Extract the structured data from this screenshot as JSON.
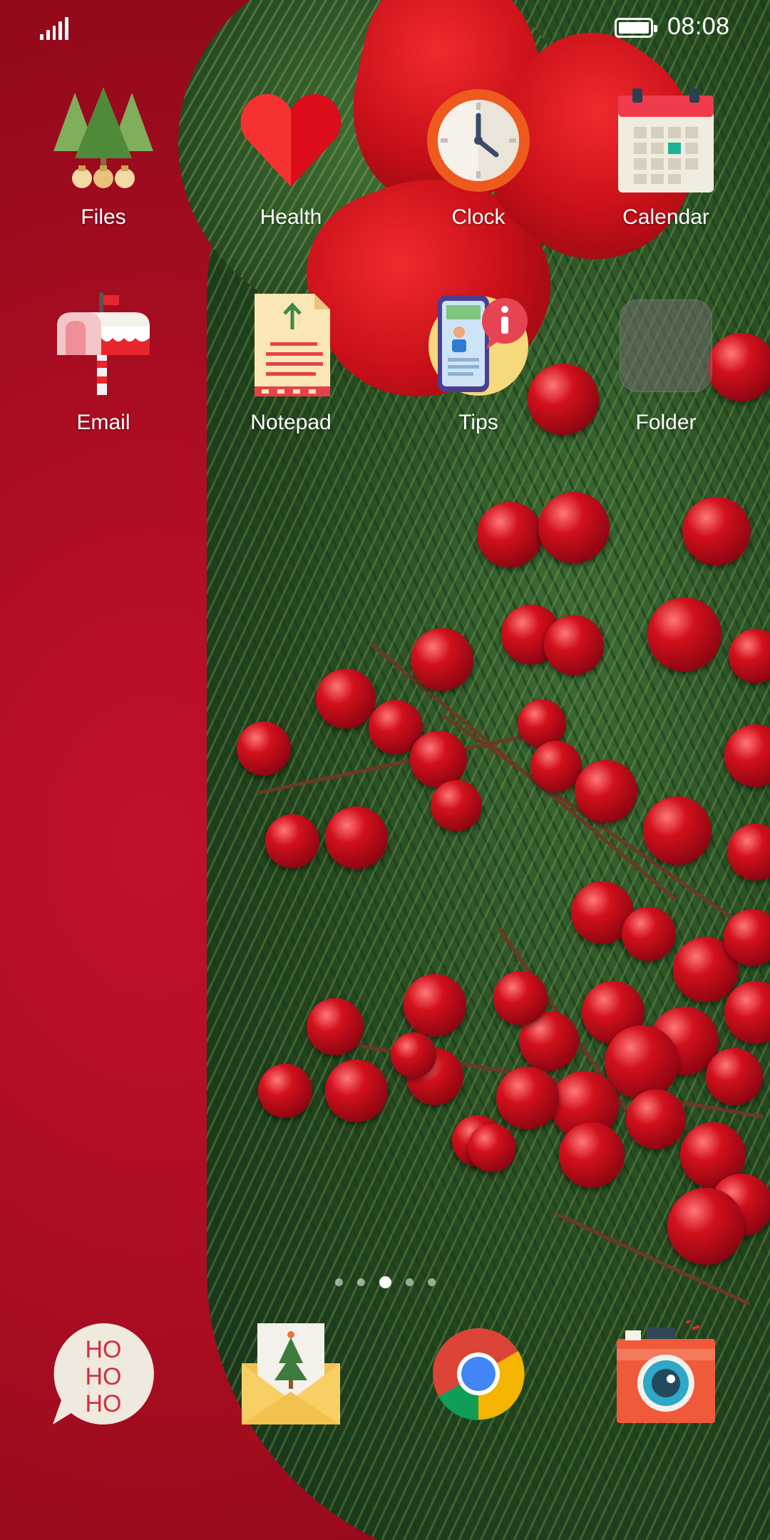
{
  "status_bar": {
    "time": "08:08",
    "signal_icon": "signal-icon",
    "battery_icon": "battery-icon"
  },
  "home_apps": [
    {
      "label": "Files",
      "icon": "pine-trees-icon"
    },
    {
      "label": "Health",
      "icon": "heart-icon"
    },
    {
      "label": "Clock",
      "icon": "clock-icon"
    },
    {
      "label": "Calendar",
      "icon": "calendar-icon"
    },
    {
      "label": "Email",
      "icon": "mailbox-icon"
    },
    {
      "label": "Notepad",
      "icon": "notepad-icon"
    },
    {
      "label": "Tips",
      "icon": "tips-icon"
    },
    {
      "label": "Folder",
      "icon": "folder-icon"
    }
  ],
  "page_indicator": {
    "pages": 5,
    "current": 3
  },
  "dock": [
    {
      "icon": "hohoho-bubble-icon",
      "text_lines": [
        "HO",
        "HO",
        "HO"
      ]
    },
    {
      "icon": "christmas-card-icon"
    },
    {
      "icon": "chrome-icon"
    },
    {
      "icon": "camera-icon"
    }
  ],
  "colors": {
    "wallpaper_red": "#a50c20",
    "berry_red": "#d2101c",
    "pine_green": "#274a22"
  }
}
